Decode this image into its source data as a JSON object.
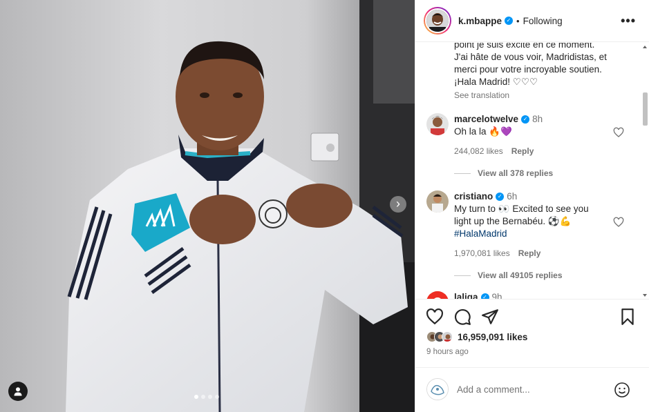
{
  "post": {
    "username": "k.mbappe",
    "follow_status": "Following",
    "separator": "•",
    "verified_badge": "✓",
    "more_label": "•••",
    "caption_lines": [
      "point je suis excité en ce moment.",
      "J'ai hâte de vous voir, Madridistas, et",
      "merci pour votre incroyable soutien.",
      "¡Hala Madrid! ♡♡♡"
    ],
    "see_translation": "See translation",
    "carousel": {
      "total_images": 4,
      "active_index": 0,
      "next_icon": "›"
    }
  },
  "comments": [
    {
      "username": "marcelotwelve",
      "time": "8h",
      "text": "Oh la la 🔥💜",
      "likes": "244,082 likes",
      "reply_label": "Reply",
      "view_replies": "View all 378 replies"
    },
    {
      "username": "cristiano",
      "time": "6h",
      "text_line1": "My turn to 👀 Excited to see you",
      "text_line2": "light up the Bernabéu. ⚽💪",
      "hashtag": "#HalaMadrid",
      "likes": "1,970,081 likes",
      "reply_label": "Reply",
      "view_replies": "View all 49105 replies"
    },
    {
      "username": "laliga",
      "time": "9h"
    }
  ],
  "actions": {
    "like_icon": "heart-icon",
    "comment_icon": "comment-icon",
    "share_icon": "paper-plane-icon",
    "save_icon": "bookmark-icon"
  },
  "likes_count": "16,959,091 likes",
  "timestamp": "9 hours ago",
  "add_comment": {
    "placeholder": "Add a comment...",
    "value": ""
  },
  "colors": {
    "verified": "#0095f6",
    "text": "#262626",
    "secondary": "#737373",
    "hashtag": "#00376b",
    "laliga_red": "#ee2e24"
  }
}
